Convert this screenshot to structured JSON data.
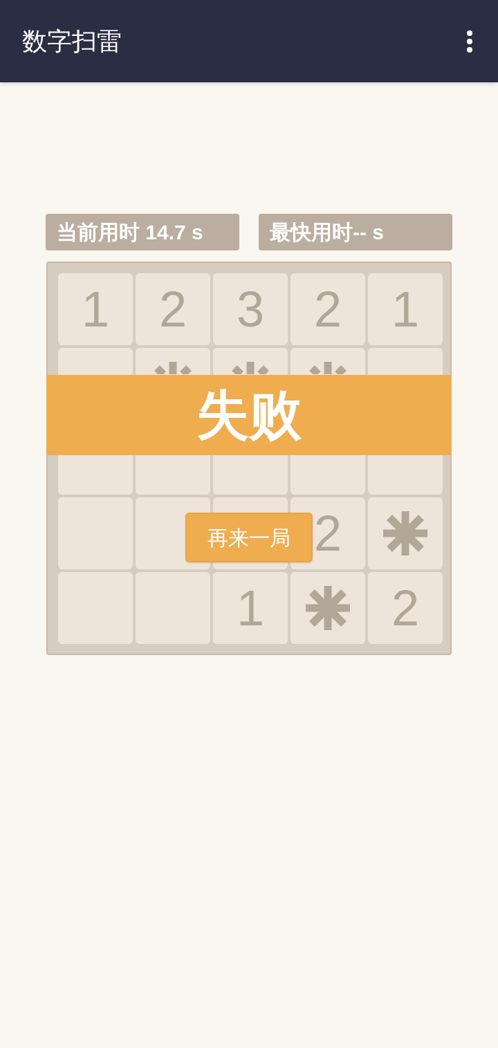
{
  "app_bar": {
    "title": "数字扫雷"
  },
  "stats": [
    {
      "label": "当前用时 14.7 s"
    },
    {
      "label": "最快用时-- s"
    }
  ],
  "board": {
    "rows": [
      [
        {
          "kind": "number",
          "value": "1"
        },
        {
          "kind": "number",
          "value": "2"
        },
        {
          "kind": "number",
          "value": "3"
        },
        {
          "kind": "number",
          "value": "2"
        },
        {
          "kind": "number",
          "value": "1"
        }
      ],
      [
        {
          "kind": "covered"
        },
        {
          "kind": "covered_mine"
        },
        {
          "kind": "covered_mine"
        },
        {
          "kind": "covered_mine"
        },
        {
          "kind": "covered"
        }
      ],
      [
        {
          "kind": "covered"
        },
        {
          "kind": "covered"
        },
        {
          "kind": "covered"
        },
        {
          "kind": "covered"
        },
        {
          "kind": "covered"
        }
      ],
      [
        {
          "kind": "empty"
        },
        {
          "kind": "empty"
        },
        {
          "kind": "empty"
        },
        {
          "kind": "number",
          "value": "2"
        },
        {
          "kind": "mine"
        }
      ],
      [
        {
          "kind": "empty"
        },
        {
          "kind": "empty"
        },
        {
          "kind": "number",
          "value": "1"
        },
        {
          "kind": "mine"
        },
        {
          "kind": "number",
          "value": "2"
        }
      ]
    ]
  },
  "result_banner": {
    "text": "失败"
  },
  "restart_button": {
    "label": "再来一局"
  }
}
